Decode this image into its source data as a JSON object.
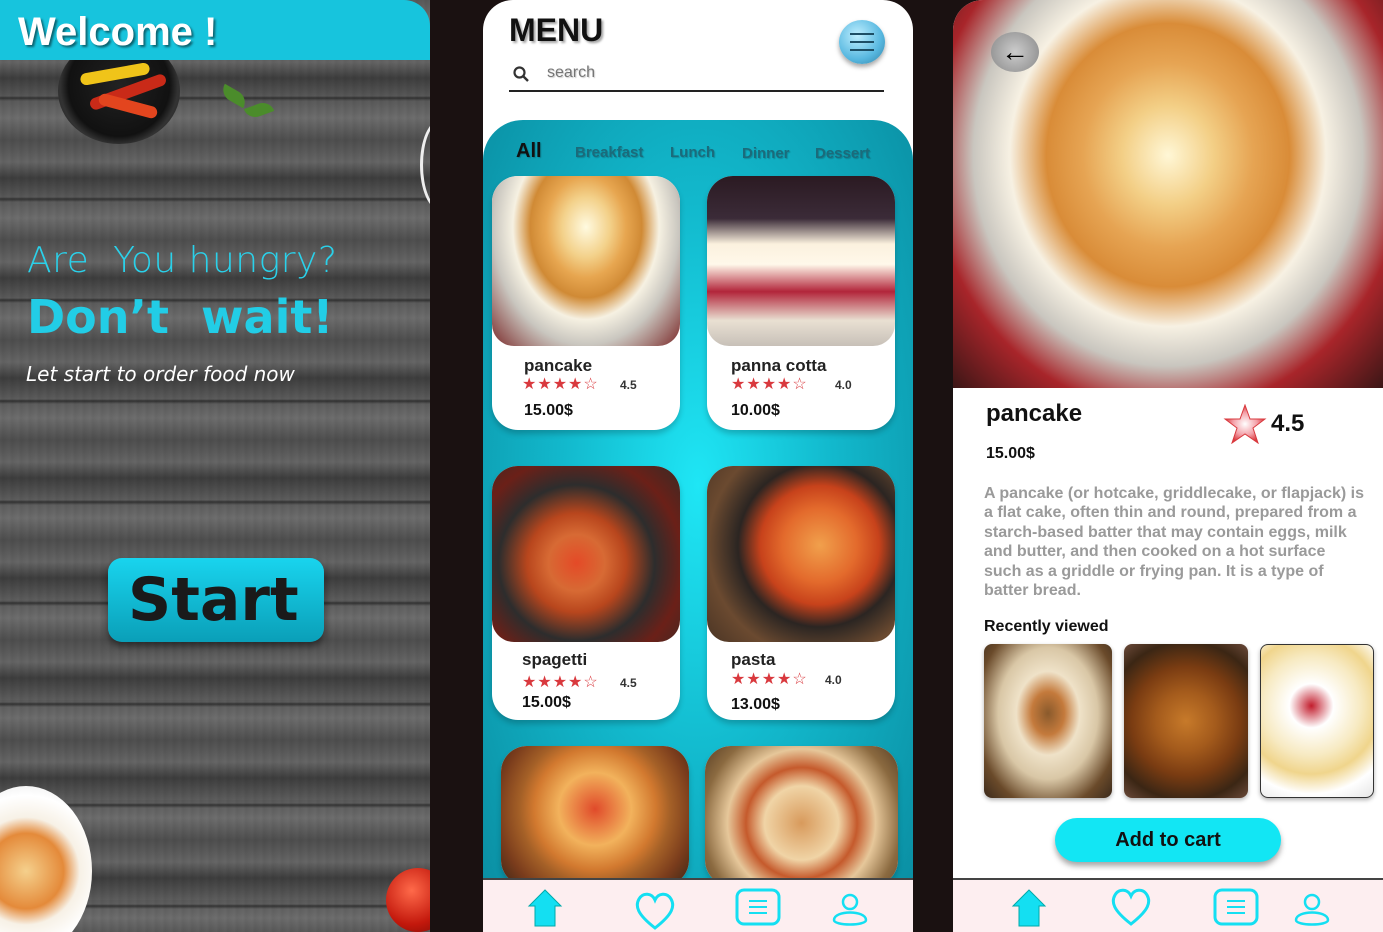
{
  "welcome_screen": {
    "title": "Welcome !",
    "question": "Are  You hungry?",
    "headline": "Don’t  wait!",
    "subtitle": "Let start to order food now",
    "start_label": "Start"
  },
  "menu_screen": {
    "title": "MENU",
    "search_placeholder": "search",
    "tabs": [
      "All",
      "Breakfast",
      "Lunch",
      "Dinner",
      "Dessert"
    ],
    "active_tab": "All",
    "items": [
      {
        "name": "pancake",
        "stars": "★★★★☆",
        "rating": "4.5",
        "price": "15.00$"
      },
      {
        "name": "panna cotta",
        "stars": "★★★★☆",
        "rating": "4.0",
        "price": "10.00$"
      },
      {
        "name": "spagetti",
        "stars": "★★★★☆",
        "rating": "4.5",
        "price": "15.00$"
      },
      {
        "name": "pasta",
        "stars": "★★★★☆",
        "rating": "4.0",
        "price": "13.00$"
      }
    ],
    "nav": [
      "home-icon",
      "heart-icon",
      "list-icon",
      "profile-icon"
    ]
  },
  "detail_screen": {
    "back_label": "←",
    "name": "pancake",
    "rating": "4.5",
    "price": "15.00$",
    "description": "A pancake (or hotcake, griddlecake, or flapjack) is a flat cake, often thin and round, prepared from a starch-based batter that may contain eggs, milk and butter, and then cooked on a hot surface such as a griddle or frying pan. It is a type of batter bread.",
    "recent_title": "Recently viewed",
    "add_to_cart_label": "Add to cart"
  },
  "colors": {
    "accent": "#12e6f4",
    "teal": "#17c4dd",
    "star_red": "#d9393e",
    "nav_bg": "#fdeef0"
  }
}
